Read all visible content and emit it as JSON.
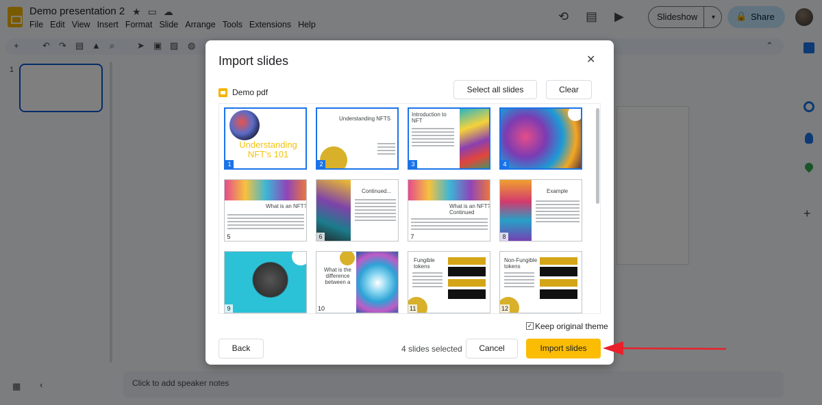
{
  "app": {
    "doc_title": "Demo presentation 2",
    "menu": [
      "File",
      "Edit",
      "View",
      "Insert",
      "Format",
      "Slide",
      "Arrange",
      "Tools",
      "Extensions",
      "Help"
    ],
    "slideshow_label": "Slideshow",
    "share_label": "Share",
    "slide_number": "1",
    "notes_placeholder": "Click to add speaker notes"
  },
  "icons": {
    "star": "★",
    "folder": "▭",
    "cloud": "☁",
    "history": "⟲",
    "comment": "▤",
    "camera": "▶",
    "lock": "🔒",
    "grid": "▦",
    "collapse": "‹",
    "close": "✕",
    "check": "✓"
  },
  "dialog": {
    "title": "Import slides",
    "source_name": "Demo pdf",
    "select_all_label": "Select all slides",
    "clear_label": "Clear",
    "keep_theme_label": "Keep original theme",
    "keep_theme_checked": true,
    "back_label": "Back",
    "selected_count_text": "4 slides selected",
    "cancel_label": "Cancel",
    "import_label": "Import slides",
    "slides": [
      {
        "num": "1",
        "selected": true,
        "title": "Understanding NFT's 101"
      },
      {
        "num": "2",
        "selected": true,
        "title": "Understanding NFTS"
      },
      {
        "num": "3",
        "selected": true,
        "title": "Introduction to NFT"
      },
      {
        "num": "4",
        "selected": true,
        "title": ""
      },
      {
        "num": "5",
        "selected": false,
        "title": "What is an NFT?"
      },
      {
        "num": "6",
        "selected": false,
        "title": "Continued..."
      },
      {
        "num": "7",
        "selected": false,
        "title": "What is an NFT? Continued"
      },
      {
        "num": "8",
        "selected": false,
        "title": "Example"
      },
      {
        "num": "9",
        "selected": false,
        "title": ""
      },
      {
        "num": "10",
        "selected": false,
        "title": "What is the difference between a"
      },
      {
        "num": "11",
        "selected": false,
        "title": "Fungible tokens"
      },
      {
        "num": "12",
        "selected": false,
        "title": "Non-Fungible tokens"
      }
    ]
  },
  "colors": {
    "accent_blue": "#1a73e8",
    "import_yellow": "#fbbc04",
    "share_blue": "#c2e7ff",
    "arrow_red": "#e8202a"
  }
}
